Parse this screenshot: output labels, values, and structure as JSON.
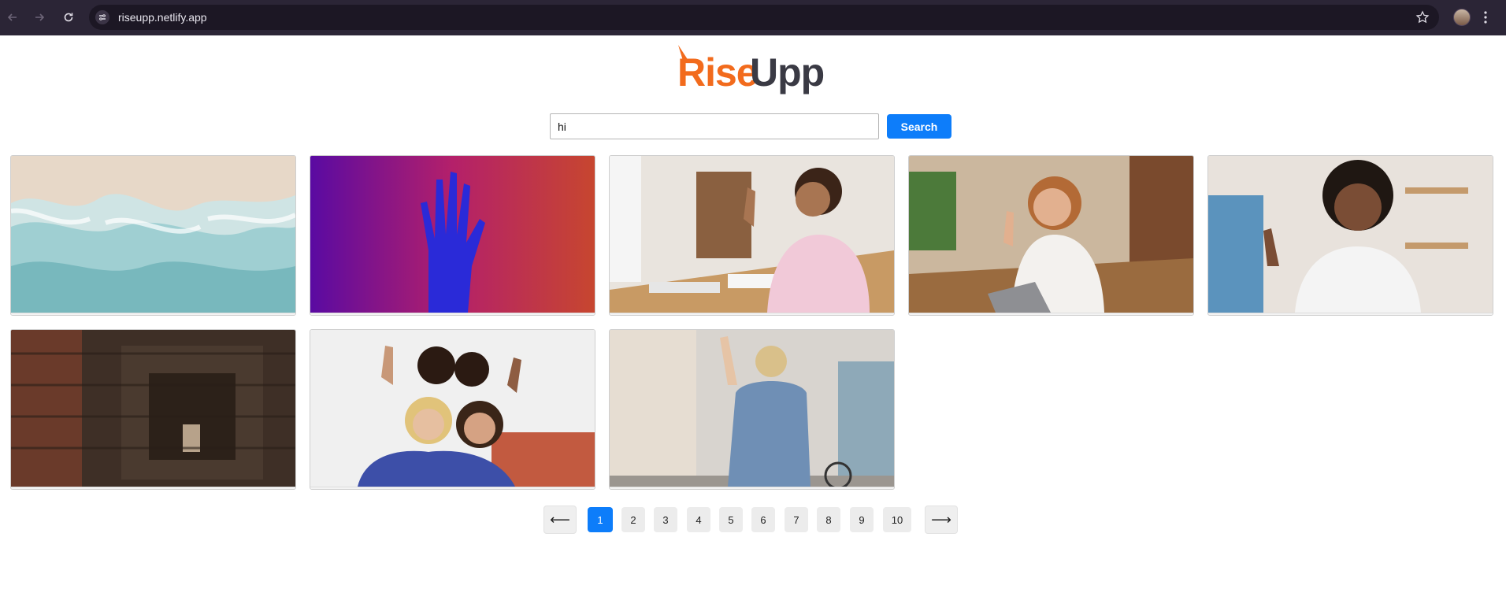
{
  "browser": {
    "url": "riseupp.netlify.app",
    "icons": [
      "back-arrow-icon",
      "forward-arrow-icon",
      "reload-icon",
      "site-settings-icon",
      "bookmark-star-icon",
      "profile-avatar",
      "menu-kebab-icon"
    ]
  },
  "logo": {
    "part1": "Rise",
    "part2": "Upp",
    "colors": {
      "orange": "#f26b1d",
      "dark": "#3a3a44"
    }
  },
  "search": {
    "value": "hi",
    "button_label": "Search"
  },
  "images": [
    {
      "alt": "ocean foam waves on sand"
    },
    {
      "alt": "blue hand on red-purple background"
    },
    {
      "alt": "girl waving at computer desk"
    },
    {
      "alt": "woman waving at laptop in cafe"
    },
    {
      "alt": "child waving in bedroom"
    },
    {
      "alt": "hand waving through brick ruin window"
    },
    {
      "alt": "group of women waving"
    },
    {
      "alt": "woman waving with bicycle in street"
    }
  ],
  "pagination": {
    "prev": "⟵",
    "next": "⟶",
    "pages": [
      "1",
      "2",
      "3",
      "4",
      "5",
      "6",
      "7",
      "8",
      "9",
      "10"
    ],
    "current": "1"
  },
  "colors": {
    "accent": "#0d7dfa",
    "chrome": "#2b2536"
  }
}
